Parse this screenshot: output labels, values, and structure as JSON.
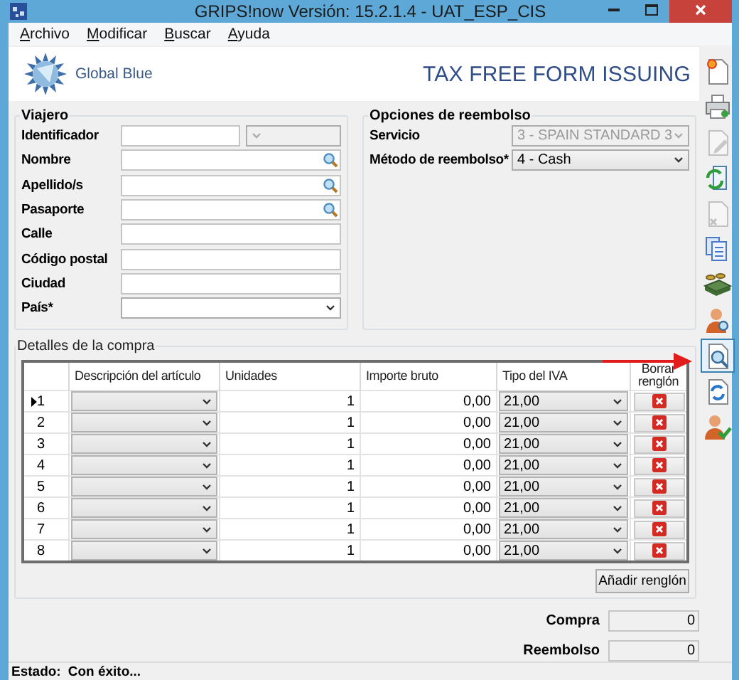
{
  "window": {
    "title": "GRIPS!now Versión: 15.2.1.4 - UAT_ESP_CIS"
  },
  "menu": [
    {
      "label": "Archivo"
    },
    {
      "label": "Modificar"
    },
    {
      "label": "Buscar"
    },
    {
      "label": "Ayuda"
    }
  ],
  "header": {
    "brand": "Global Blue",
    "title": "TAX FREE FORM ISSUING"
  },
  "traveler": {
    "title": "Viajero",
    "fields": [
      {
        "label": "Identificador",
        "kind": "id"
      },
      {
        "label": "Nombre",
        "kind": "search"
      },
      {
        "label": "Apellido/s",
        "kind": "search"
      },
      {
        "label": "Pasaporte",
        "kind": "search"
      },
      {
        "label": "Calle",
        "kind": "text"
      },
      {
        "label": "Código postal",
        "kind": "text"
      },
      {
        "label": "Ciudad",
        "kind": "text"
      },
      {
        "label": "País*",
        "kind": "select"
      }
    ]
  },
  "refund": {
    "title": "Opciones de reembolso",
    "fields": [
      {
        "label": "Servicio",
        "value": "3 - SPAIN STANDARD 3",
        "disabled": true
      },
      {
        "label": "Método de reembolso*",
        "value": "4 - Cash",
        "disabled": false
      }
    ]
  },
  "purchase": {
    "title": "Detalles de la compra",
    "columns": [
      "Descripción del artículo",
      "Unidades",
      "Importe bruto",
      "Tipo del IVA",
      "Borrar renglón"
    ],
    "rows": [
      {
        "number": "1",
        "units": "1",
        "amount": "0,00",
        "vat": "21,00",
        "current": true
      },
      {
        "number": "2",
        "units": "1",
        "amount": "0,00",
        "vat": "21,00",
        "current": false
      },
      {
        "number": "3",
        "units": "1",
        "amount": "0,00",
        "vat": "21,00",
        "current": false
      },
      {
        "number": "4",
        "units": "1",
        "amount": "0,00",
        "vat": "21,00",
        "current": false
      },
      {
        "number": "5",
        "units": "1",
        "amount": "0,00",
        "vat": "21,00",
        "current": false
      },
      {
        "number": "6",
        "units": "1",
        "amount": "0,00",
        "vat": "21,00",
        "current": false
      },
      {
        "number": "7",
        "units": "1",
        "amount": "0,00",
        "vat": "21,00",
        "current": false
      },
      {
        "number": "8",
        "units": "1",
        "amount": "0,00",
        "vat": "21,00",
        "current": false
      }
    ],
    "add_button": "Añadir renglón"
  },
  "totals": [
    {
      "label": "Compra",
      "value": "0"
    },
    {
      "label": "Reembolso",
      "value": "0"
    }
  ],
  "toolbar": [
    {
      "kind": "new",
      "disabled": false,
      "selected": false
    },
    {
      "kind": "print",
      "disabled": false,
      "selected": false
    },
    {
      "kind": "edit",
      "disabled": true,
      "selected": false
    },
    {
      "kind": "refresh-doc",
      "disabled": false,
      "selected": false
    },
    {
      "kind": "delete-doc",
      "disabled": true,
      "selected": false
    },
    {
      "kind": "copies",
      "disabled": false,
      "selected": false
    },
    {
      "kind": "money",
      "disabled": false,
      "selected": false
    },
    {
      "kind": "user-search",
      "disabled": false,
      "selected": false
    },
    {
      "kind": "doc-search",
      "disabled": false,
      "selected": true
    },
    {
      "kind": "sync",
      "disabled": false,
      "selected": false
    },
    {
      "kind": "user-ok",
      "disabled": false,
      "selected": false
    }
  ],
  "status": {
    "label": "Estado:",
    "value": "Con éxito..."
  }
}
